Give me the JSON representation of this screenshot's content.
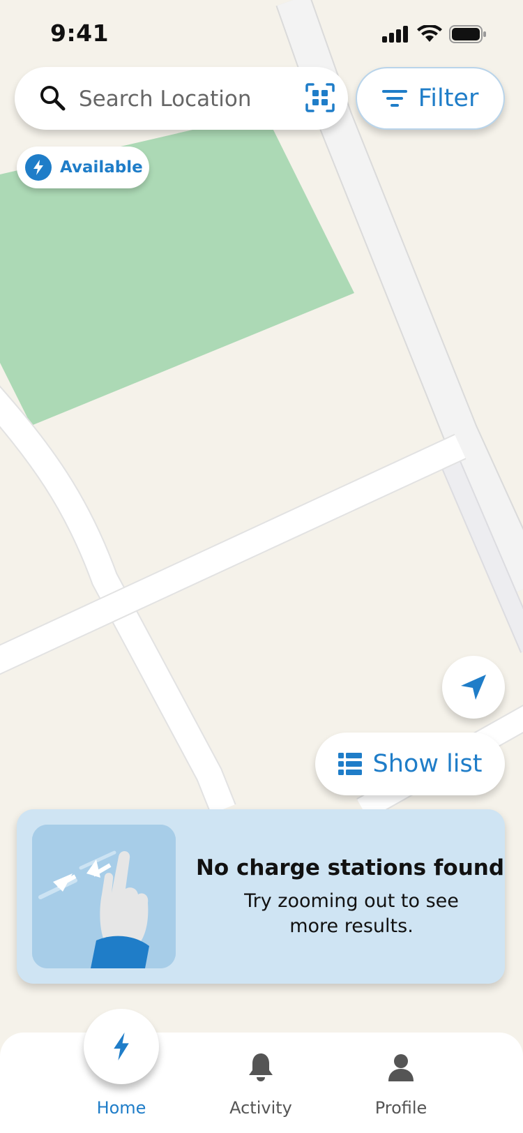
{
  "status_bar": {
    "time": "9:41"
  },
  "search": {
    "placeholder": "Search Location",
    "icon": "search-icon",
    "scan_icon": "qr-scan-icon"
  },
  "filter": {
    "label": "Filter",
    "icon": "filter-icon"
  },
  "availability_chip": {
    "label": "Available",
    "icon": "bolt-icon"
  },
  "map_controls": {
    "locate_icon": "navigation-arrow-icon",
    "show_list_label": "Show list",
    "show_list_icon": "list-icon"
  },
  "empty_state": {
    "title": "No charge stations found",
    "message": "Try zooming out to see more results.",
    "illustration": "pinch-zoom-hand-illustration"
  },
  "tabbar": {
    "items": [
      {
        "label": "Home",
        "icon": "bolt-icon",
        "active": true
      },
      {
        "label": "Activity",
        "icon": "bell-icon",
        "active": false
      },
      {
        "label": "Profile",
        "icon": "user-icon",
        "active": false
      }
    ]
  },
  "colors": {
    "accent": "#1f7dc8",
    "map_background": "#f5f2ea",
    "park": "#acd9b5",
    "card_background": "#cfe4f3"
  }
}
